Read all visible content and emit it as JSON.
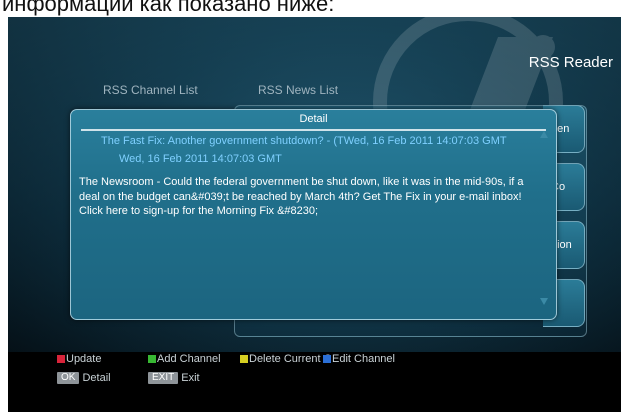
{
  "caption": {
    "text": "информации как показано ниже:"
  },
  "app": {
    "title": "RSS Reader"
  },
  "columns": {
    "channel_list": "RSS Channel List",
    "news_list": "RSS News List"
  },
  "side_tabs": [
    "den",
    "Co",
    "hion",
    ""
  ],
  "detail": {
    "title": "Detail",
    "headline": "The Fast Fix: Another government shutdown? -   (TWed, 16 Feb 2011 14:07:03 GMT",
    "date": "Wed, 16 Feb 2011 14:07:03 GMT",
    "body": "The Newsroom - Could the federal government be shut down, like it was in the mid-90s, if a deal on the budget can&#039;t be reached by March 4th? Get The Fix in your e-mail inbox! Click here to sign-up for the Morning Fix &#8230;"
  },
  "legend": {
    "update": "Update",
    "add_channel": "Add Channel",
    "delete_current": "Delete Current C",
    "edit_channel": "Edit Channel",
    "ok_key": "OK",
    "ok_label": "Detail",
    "exit_key": "EXIT",
    "exit_label": "Exit"
  },
  "colors": {
    "red": "#d8243a",
    "green": "#38b833",
    "yellow": "#d6cf22",
    "blue": "#2b6fd6",
    "link": "#7fd0ff"
  },
  "icons": {
    "red_button": "red-square-icon",
    "green_button": "green-square-icon",
    "yellow_button": "yellow-square-icon",
    "blue_button": "blue-square-icon",
    "scroll_up": "triangle-up-icon",
    "scroll_down": "triangle-down-icon"
  }
}
